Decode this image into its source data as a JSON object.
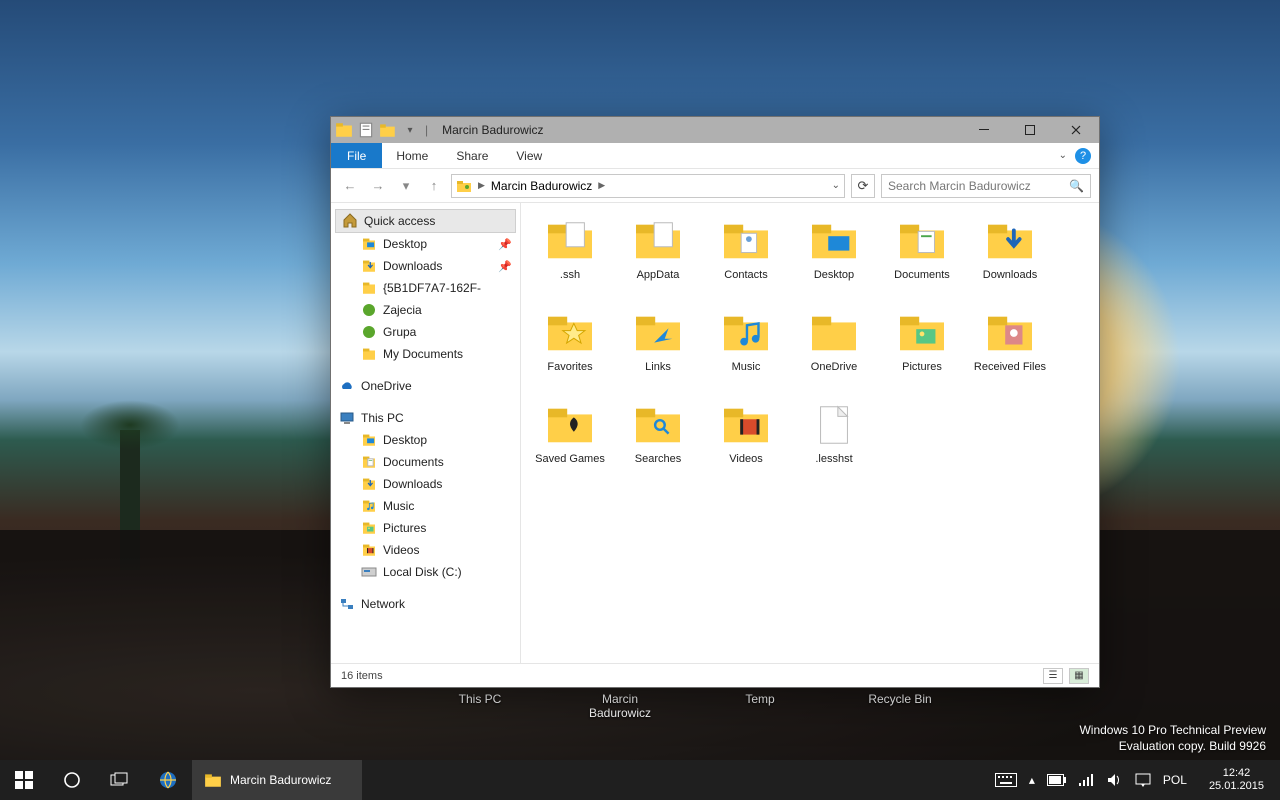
{
  "desktop_icons": [
    "This PC",
    "Marcin Badurowicz",
    "Temp",
    "Recycle Bin"
  ],
  "watermark": {
    "line1": "Windows 10 Pro Technical Preview",
    "line2": "Evaluation copy. Build 9926"
  },
  "taskbar": {
    "active_label": "Marcin Badurowicz",
    "lang": "POL",
    "time": "12:42",
    "date": "25.01.2015"
  },
  "window": {
    "title": "Marcin Badurowicz",
    "tabs": {
      "file": "File",
      "home": "Home",
      "share": "Share",
      "view": "View"
    },
    "address": {
      "root_hint": "",
      "crumb": "Marcin Badurowicz"
    },
    "search_placeholder": "Search Marcin Badurowicz",
    "nav": {
      "quick_access": "Quick access",
      "qa_items": [
        {
          "label": "Desktop",
          "pinned": true,
          "icon": "desktop"
        },
        {
          "label": "Downloads",
          "pinned": true,
          "icon": "downloads"
        },
        {
          "label": "{5B1DF7A7-162F-",
          "pinned": false,
          "icon": "folder"
        },
        {
          "label": "Zajecia",
          "pinned": false,
          "icon": "green"
        },
        {
          "label": "Grupa",
          "pinned": false,
          "icon": "green"
        },
        {
          "label": "My Documents",
          "pinned": false,
          "icon": "folder"
        }
      ],
      "onedrive": "OneDrive",
      "this_pc": "This PC",
      "pc_items": [
        {
          "label": "Desktop",
          "icon": "desktop"
        },
        {
          "label": "Documents",
          "icon": "documents"
        },
        {
          "label": "Downloads",
          "icon": "downloads"
        },
        {
          "label": "Music",
          "icon": "music"
        },
        {
          "label": "Pictures",
          "icon": "pictures"
        },
        {
          "label": "Videos",
          "icon": "videos"
        },
        {
          "label": "Local Disk (C:)",
          "icon": "disk"
        }
      ],
      "network": "Network"
    },
    "items": [
      {
        "label": ".ssh",
        "icon": "folder-doc"
      },
      {
        "label": "AppData",
        "icon": "folder-doc"
      },
      {
        "label": "Contacts",
        "icon": "contacts"
      },
      {
        "label": "Desktop",
        "icon": "desktop"
      },
      {
        "label": "Documents",
        "icon": "documents"
      },
      {
        "label": "Downloads",
        "icon": "downloads"
      },
      {
        "label": "Favorites",
        "icon": "favorites"
      },
      {
        "label": "Links",
        "icon": "links"
      },
      {
        "label": "Music",
        "icon": "music"
      },
      {
        "label": "OneDrive",
        "icon": "folder"
      },
      {
        "label": "Pictures",
        "icon": "pictures"
      },
      {
        "label": "Received Files",
        "icon": "received"
      },
      {
        "label": "Saved Games",
        "icon": "games"
      },
      {
        "label": "Searches",
        "icon": "searches"
      },
      {
        "label": "Videos",
        "icon": "videos"
      },
      {
        "label": ".lesshst",
        "icon": "file"
      }
    ],
    "status": "16 items"
  }
}
